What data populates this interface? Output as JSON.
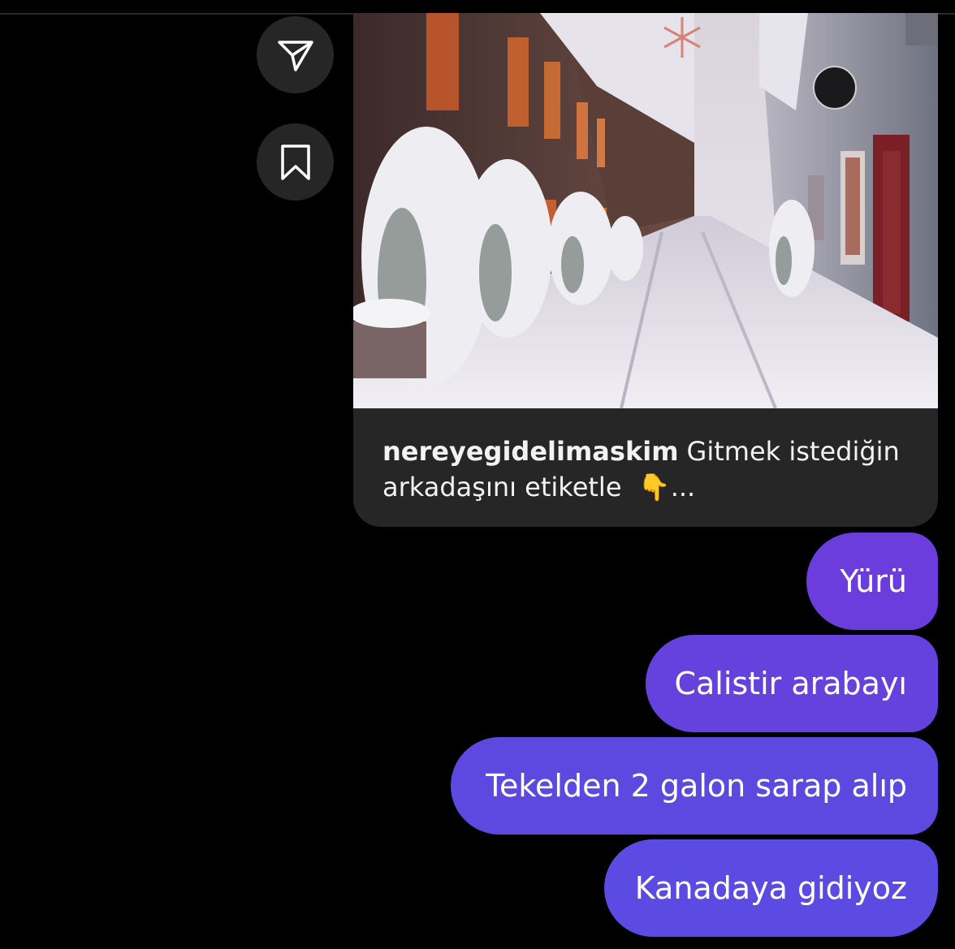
{
  "post": {
    "username": "nereyegidelimaskim",
    "caption_text": "Gitmek istediğin arkadaşını etiketle",
    "caption_emoji": "👇",
    "caption_more": "...",
    "image_logo_name": "ecogriffe-logo"
  },
  "actions": {
    "share_icon": "paper-plane-icon",
    "save_icon": "bookmark-icon"
  },
  "messages": [
    {
      "text": "Yürü"
    },
    {
      "text": "Calistir arabayı"
    },
    {
      "text": "Tekelden 2 galon sarap alıp"
    },
    {
      "text": "Kanadaya gidiyoz"
    }
  ],
  "colors": {
    "background": "#000000",
    "card": "#262626",
    "bubble_top": "#6b3ddc",
    "bubble_bottom": "#5b4be2"
  }
}
